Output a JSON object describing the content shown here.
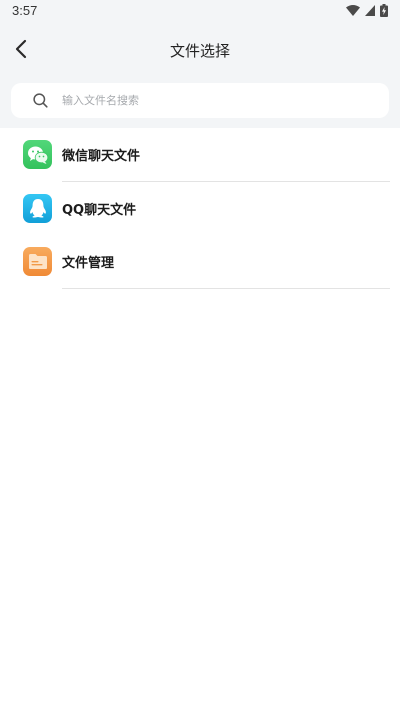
{
  "status_bar": {
    "time": "3:57",
    "icons": [
      "wifi-icon",
      "cellular-signal-icon",
      "battery-charging-icon"
    ]
  },
  "header": {
    "back_icon": "chevron-left-icon",
    "title": "文件选择"
  },
  "search": {
    "icon": "search-icon",
    "value": "",
    "placeholder": "输入文件名搜索"
  },
  "list": {
    "items": [
      {
        "label": "微信聊天文件",
        "icon": "wechat-icon",
        "color": "#3fcf6a",
        "divider": true
      },
      {
        "label": "QQ聊天文件",
        "icon": "qq-icon",
        "color": "#1eb5ee",
        "divider": false
      },
      {
        "label": "文件管理",
        "icon": "folder-icon",
        "color": "#f59a45",
        "divider": true
      }
    ]
  },
  "colors": {
    "header_background": "#f3f5f7",
    "page_background": "#ffffff",
    "divider": "#e3e3e3"
  }
}
